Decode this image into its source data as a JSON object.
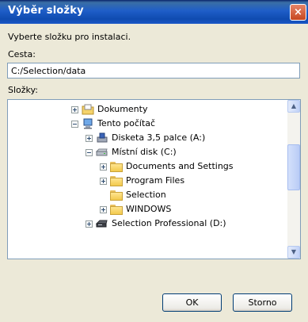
{
  "window": {
    "title": "Výběr složky",
    "close_label": "×"
  },
  "instruction": "Vyberte složku pro instalaci.",
  "path": {
    "label": "Cesta:",
    "value": "C:/Selection/data"
  },
  "folders_label": "Složky:",
  "tree": [
    {
      "label": "Dokumenty",
      "expander": "plus",
      "icon": "documents-folder-icon"
    },
    {
      "label": "Tento počítač",
      "expander": "minus",
      "icon": "computer-icon"
    },
    {
      "label": "Disketa 3,5 palce (A:)",
      "expander": "plus",
      "icon": "floppy-drive-icon"
    },
    {
      "label": "Místní disk (C:)",
      "expander": "minus",
      "icon": "hard-drive-icon"
    },
    {
      "label": "Documents and Settings",
      "expander": "plus",
      "icon": "folder-icon"
    },
    {
      "label": "Program Files",
      "expander": "plus",
      "icon": "folder-icon"
    },
    {
      "label": "Selection",
      "expander": "none",
      "icon": "folder-icon"
    },
    {
      "label": "WINDOWS",
      "expander": "plus",
      "icon": "folder-icon"
    },
    {
      "label": "Selection Professional (D:)",
      "expander": "plus",
      "icon": "cd-drive-icon"
    }
  ],
  "buttons": {
    "ok": "OK",
    "cancel": "Storno"
  },
  "scrollbar": {
    "up_arrow": "▲",
    "down_arrow": "▼"
  }
}
